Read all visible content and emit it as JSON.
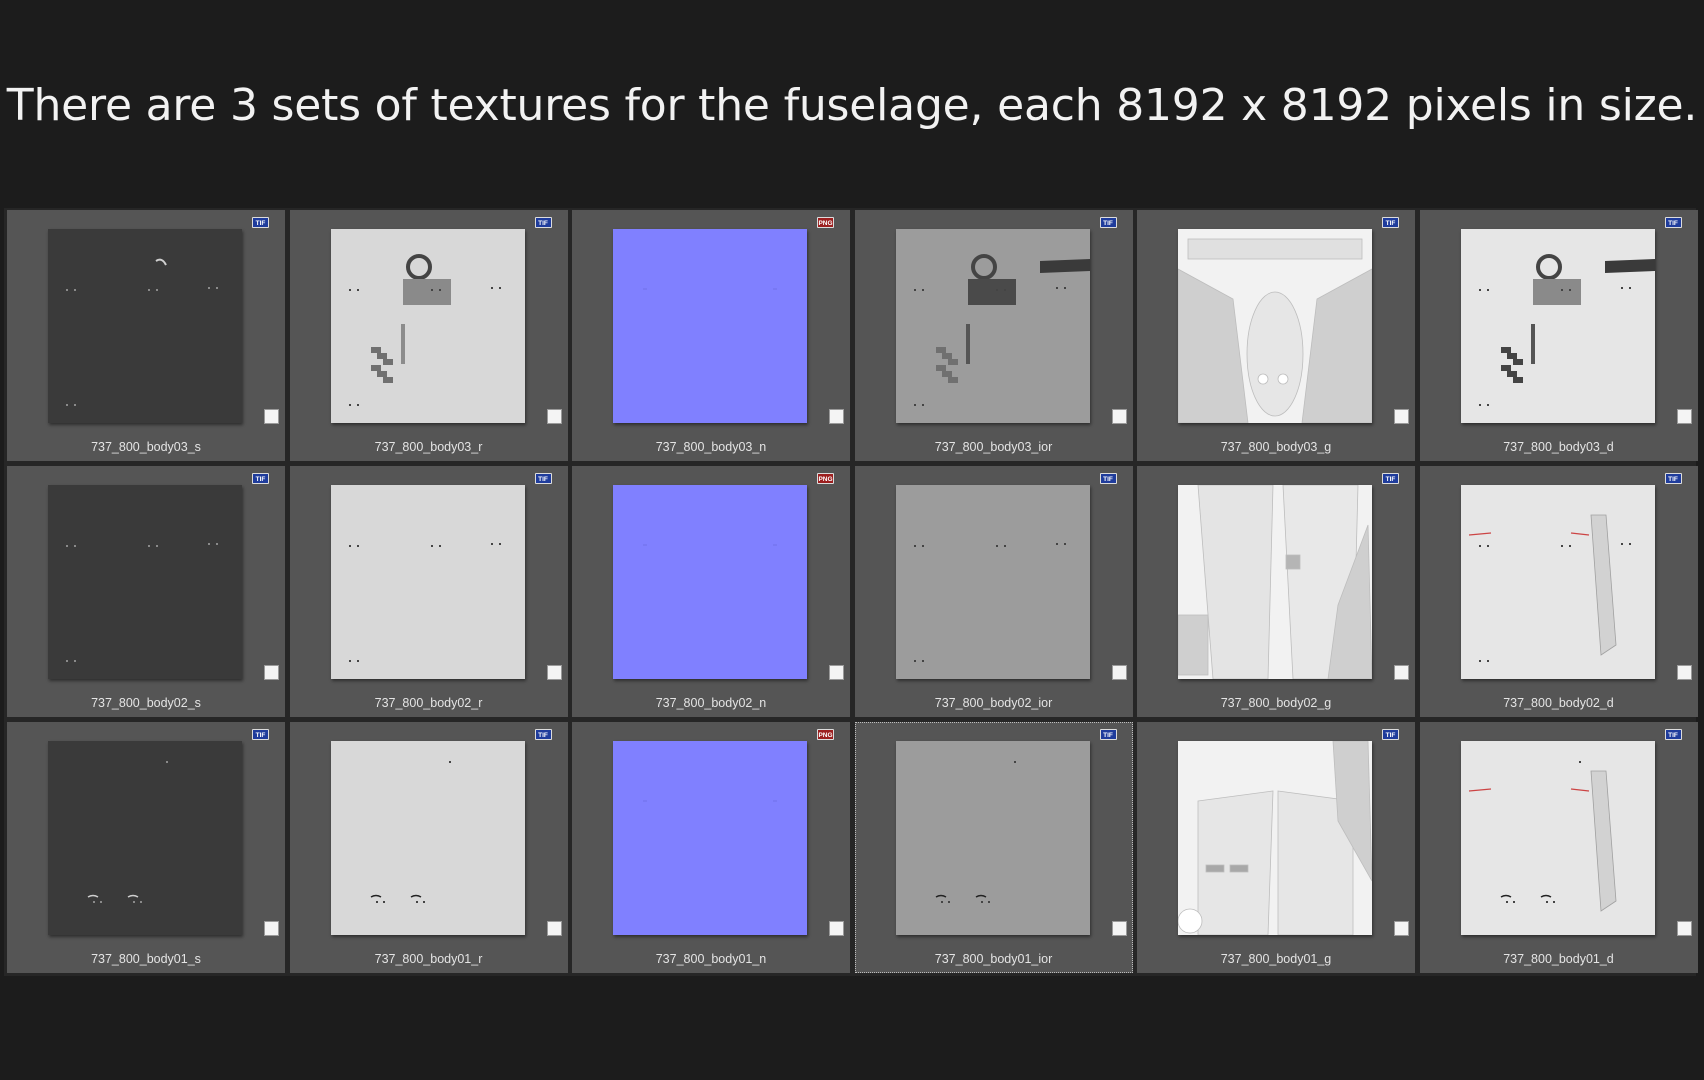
{
  "headline": "There are 3 sets of textures for the fuselage, each 8192 x 8192 pixels in size.",
  "tiles": [
    {
      "filename": "737_800_body03_s",
      "badge": "TIF",
      "kind": "s"
    },
    {
      "filename": "737_800_body03_r",
      "badge": "TIF",
      "kind": "r"
    },
    {
      "filename": "737_800_body03_n",
      "badge": "PNG",
      "kind": "n"
    },
    {
      "filename": "737_800_body03_ior",
      "badge": "TIF",
      "kind": "ior"
    },
    {
      "filename": "737_800_body03_g",
      "badge": "TIF",
      "kind": "g"
    },
    {
      "filename": "737_800_body03_d",
      "badge": "TIF",
      "kind": "d"
    },
    {
      "filename": "737_800_body02_s",
      "badge": "TIF",
      "kind": "s"
    },
    {
      "filename": "737_800_body02_r",
      "badge": "TIF",
      "kind": "r"
    },
    {
      "filename": "737_800_body02_n",
      "badge": "PNG",
      "kind": "n"
    },
    {
      "filename": "737_800_body02_ior",
      "badge": "TIF",
      "kind": "ior"
    },
    {
      "filename": "737_800_body02_g",
      "badge": "TIF",
      "kind": "g"
    },
    {
      "filename": "737_800_body02_d",
      "badge": "TIF",
      "kind": "d"
    },
    {
      "filename": "737_800_body01_s",
      "badge": "TIF",
      "kind": "s"
    },
    {
      "filename": "737_800_body01_r",
      "badge": "TIF",
      "kind": "r"
    },
    {
      "filename": "737_800_body01_n",
      "badge": "PNG",
      "kind": "n"
    },
    {
      "filename": "737_800_body01_ior",
      "badge": "TIF",
      "kind": "ior",
      "focused": true
    },
    {
      "filename": "737_800_body01_g",
      "badge": "TIF",
      "kind": "g"
    },
    {
      "filename": "737_800_body01_d",
      "badge": "TIF",
      "kind": "d"
    }
  ],
  "map_colors": {
    "s": "#3a3a3a",
    "r": "#d8d8d8",
    "n": "#8080ff",
    "ior": "#9c9c9c",
    "g": "#f2f2f2",
    "d": "#e6e6e6"
  },
  "badge_colors": {
    "TIF": "#1f3c9c",
    "PNG": "#9c1f1f"
  },
  "panel_color": "#555555",
  "background_color": "#1c1c1c"
}
